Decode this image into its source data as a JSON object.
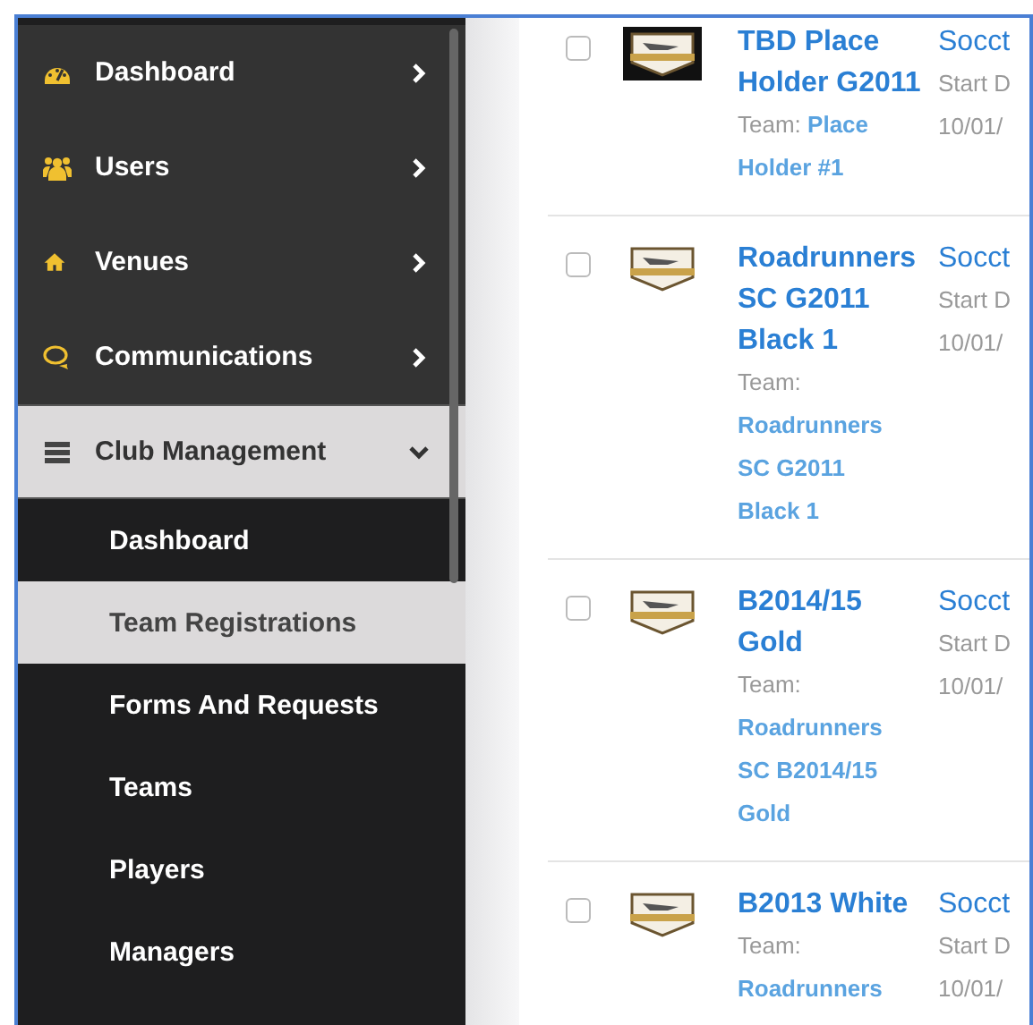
{
  "sidebar": {
    "items": [
      {
        "label": "Dashboard",
        "expanded": false,
        "selected": false
      },
      {
        "label": "Users",
        "expanded": false,
        "selected": false
      },
      {
        "label": "Venues",
        "expanded": false,
        "selected": false
      },
      {
        "label": "Communications",
        "expanded": false,
        "selected": false
      },
      {
        "label": "Club Management",
        "expanded": true,
        "selected": true,
        "children": [
          {
            "label": "Dashboard",
            "selected": false
          },
          {
            "label": "Team Registrations",
            "selected": true
          },
          {
            "label": "Forms And Requests",
            "selected": false
          },
          {
            "label": "Teams",
            "selected": false
          },
          {
            "label": "Players",
            "selected": false
          },
          {
            "label": "Managers",
            "selected": false
          }
        ]
      }
    ]
  },
  "registrations": [
    {
      "checked": false,
      "kind": "dark",
      "name": "TBD Place Holder G2011",
      "team_label": "Team:",
      "team": "Place Holder #1",
      "column_3": "Socct",
      "start_label": "Start D",
      "date": "10/01/"
    },
    {
      "checked": false,
      "kind": "light",
      "name": "Roadrunners SC G2011 Black 1",
      "team_label": "Team:",
      "team": "Roadrunners SC G2011 Black 1",
      "column_3": "Socct",
      "start_label": "Start D",
      "date": "10/01/"
    },
    {
      "checked": false,
      "kind": "light",
      "name": "B2014/15 Gold",
      "team_label": "Team:",
      "team": "Roadrunners SC B2014/15 Gold",
      "column_3": "Socct",
      "start_label": "Start D",
      "date": "10/01/"
    },
    {
      "checked": false,
      "kind": "light",
      "name": "B2013 White",
      "team_label": "Team:",
      "team": "Roadrunners",
      "column_3": "Socct",
      "start_label": "Start D",
      "date": "10/01/"
    }
  ]
}
